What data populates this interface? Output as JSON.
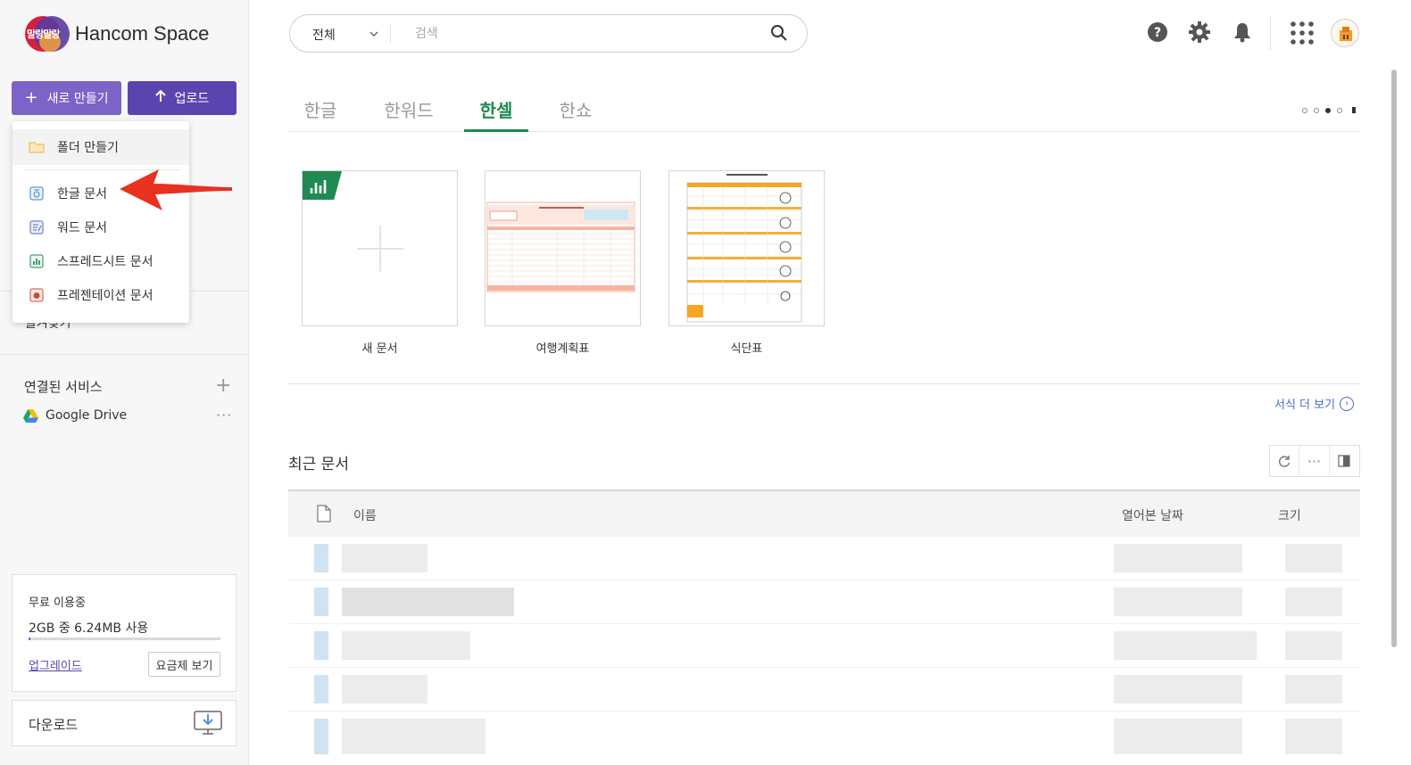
{
  "app": {
    "logo_badge": "말랑말랑",
    "logo_text": "Hancom Space"
  },
  "sidebar": {
    "new_button": "새로 만들기",
    "upload_button": "업로드",
    "new_menu": {
      "items": [
        {
          "label": "폴더 만들기",
          "icon": "folder-icon"
        },
        {
          "label": "한글 문서",
          "icon": "hwp-doc-icon"
        },
        {
          "label": "워드 문서",
          "icon": "word-doc-icon"
        },
        {
          "label": "스프레드시트 문서",
          "icon": "spreadsheet-doc-icon"
        },
        {
          "label": "프레젠테이션 문서",
          "icon": "presentation-doc-icon"
        }
      ]
    },
    "favorites_partial": "즐겨찾기",
    "linked_services": {
      "title": "연결된 서비스",
      "items": [
        {
          "label": "Google Drive"
        }
      ]
    },
    "usage": {
      "plan_label": "무료 이용중",
      "usage_text": "2GB 중 6.24MB 사용",
      "usage_fraction": 0.003,
      "upgrade_link": "업그레이드",
      "plan_button": "요금제 보기"
    },
    "download_label": "다운로드"
  },
  "search": {
    "scope": "전체",
    "placeholder": "검색",
    "value": ""
  },
  "tabs": [
    {
      "label": "한글",
      "active": false
    },
    {
      "label": "한워드",
      "active": false
    },
    {
      "label": "한셀",
      "active": true
    },
    {
      "label": "한쇼",
      "active": false
    }
  ],
  "carousel": {
    "pages": 4,
    "current": 3
  },
  "templates": [
    {
      "name": "새 문서"
    },
    {
      "name": "여행계획표"
    },
    {
      "name": "식단표"
    }
  ],
  "more_templates_link": "서식 더 보기",
  "recent": {
    "title": "최근 문서",
    "columns": {
      "name": "이름",
      "opened": "열어본 날짜",
      "size": "크기"
    },
    "row_count": 5
  },
  "colors": {
    "accent_purple": "#7b63c8",
    "upload_purple": "#5a45b0",
    "hancell_green": "#1f8a52",
    "link_blue": "#4a6cc9",
    "arrow_red": "#e8321f"
  }
}
